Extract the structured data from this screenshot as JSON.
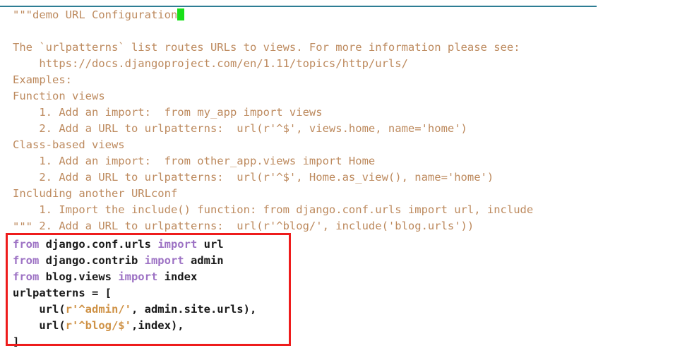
{
  "editor": {
    "language": "python",
    "filename_context": "demo URL Configuration",
    "background_color": "#ffffff",
    "rule_color": "#2e7d94",
    "caret_color": "#19e019",
    "docstring_color": "#bd8a5e",
    "keyword_color": "#9d72c4",
    "string_color": "#cf9246",
    "identifier_color": "#1a1a1a",
    "annotation_box_color": "#ee1c1c"
  },
  "docstring": {
    "line_01": "\"\"\"demo URL Configuration",
    "line_02": "",
    "line_03": "The `urlpatterns` list routes URLs to views. For more information please see:",
    "line_04": "    https://docs.djangoproject.com/en/1.11/topics/http/urls/",
    "line_05": "Examples:",
    "line_06": "Function views",
    "line_07": "    1. Add an import:  from my_app import views",
    "line_08": "    2. Add a URL to urlpatterns:  url(r'^$', views.home, name='home')",
    "line_09": "Class-based views",
    "line_10": "    1. Add an import:  from other_app.views import Home",
    "line_11": "    2. Add a URL to urlpatterns:  url(r'^$', Home.as_view(), name='home')",
    "line_12": "Including another URLconf",
    "line_13": "    1. Import the include() function: from django.conf.urls import url, include",
    "line_14": "    2. Add a URL to urlpatterns:  url(r'^blog/', include('blog.urls'))",
    "line_15": "\"\"\""
  },
  "code_block": {
    "line_16": {
      "kw1": "from",
      "mod1": " django.conf.urls ",
      "kw2": "import",
      "name1": " url"
    },
    "line_17": {
      "kw1": "from",
      "mod1": " django.contrib ",
      "kw2": "import",
      "name1": " admin"
    },
    "line_18": {
      "kw1": "from",
      "mod1": " blog.views ",
      "kw2": "import",
      "name1": " index"
    },
    "line_19": {
      "text": "urlpatterns = ["
    },
    "line_20": {
      "pre": "    url(",
      "str": "r'^admin/'",
      "post": ", admin.site.urls),"
    },
    "line_21": {
      "pre": "    url(",
      "str": "r'^blog/$'",
      "post": ",index),"
    },
    "line_22": {
      "text": "]"
    }
  }
}
